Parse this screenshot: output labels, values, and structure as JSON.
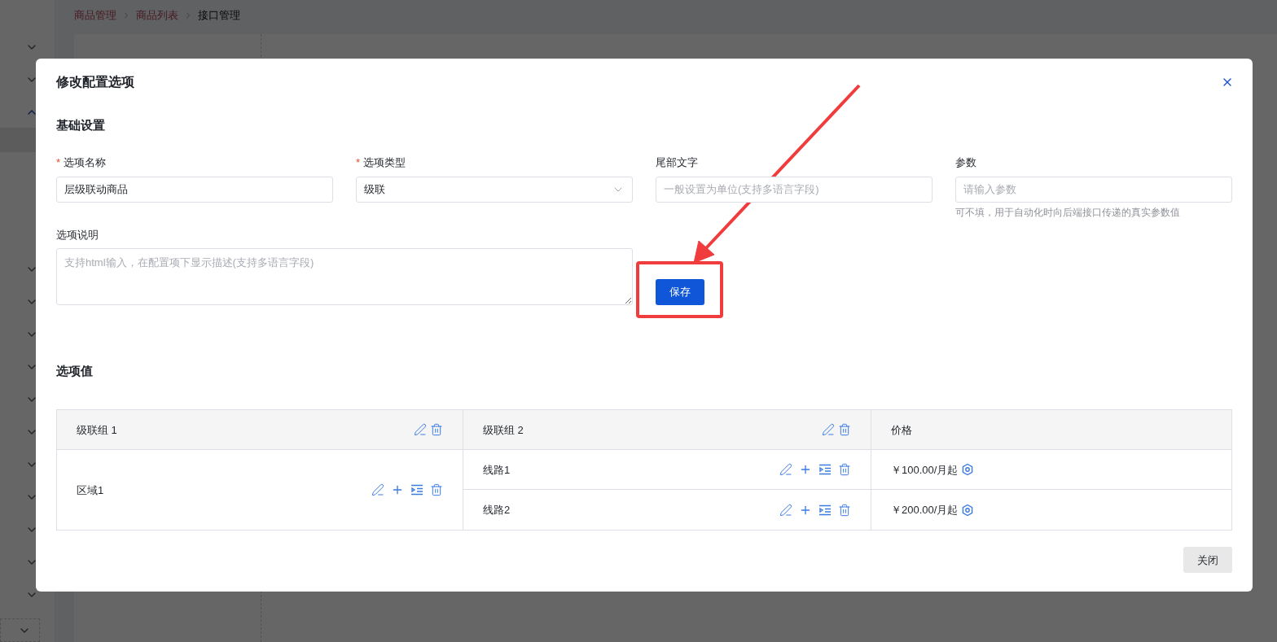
{
  "breadcrumb": [
    {
      "label": "商品管理",
      "current": false
    },
    {
      "label": "商品列表",
      "current": false
    },
    {
      "label": "接口管理",
      "current": true
    }
  ],
  "dialog": {
    "title": "修改配置选项",
    "basic": {
      "heading": "基础设置",
      "fields": [
        {
          "kind": "input",
          "label": "选项名称",
          "required_mark": "*",
          "value": "层级联动商品"
        },
        {
          "kind": "select",
          "label": "选项类型",
          "required_mark": "*",
          "value": "级联"
        },
        {
          "kind": "input",
          "label": "尾部文字",
          "placeholder": "一般设置为单位(支持多语言字段)"
        },
        {
          "kind": "input",
          "label": "参数",
          "placeholder": "请输入参数",
          "help": "可不填，用于自动化时向后端接口传递的真实参数值"
        }
      ],
      "description": {
        "label": "选项说明",
        "placeholder": "支持html输入，在配置项下显示描述(支持多语言字段)"
      },
      "save_button": "保存"
    },
    "values": {
      "heading": "选项值",
      "columns": [
        {
          "kind": "group",
          "label": "级联组 1"
        },
        {
          "kind": "group",
          "label": "级联组 2"
        },
        {
          "kind": "price",
          "label": "价格"
        }
      ],
      "groups": [
        {
          "label": "区域1",
          "children": [
            {
              "label": "线路1",
              "price": "￥100.00/月起"
            },
            {
              "label": "线路2",
              "price": "￥200.00/月起"
            }
          ]
        }
      ]
    },
    "close_button": "关闭"
  }
}
